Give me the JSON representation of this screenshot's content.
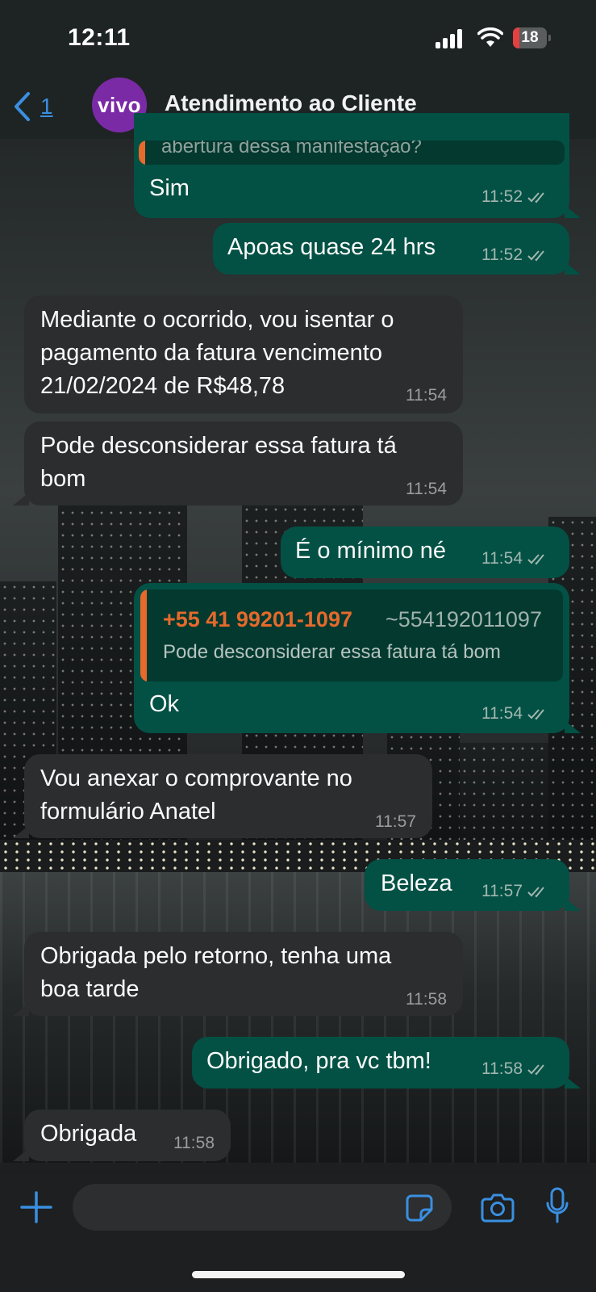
{
  "status_bar": {
    "time": "12:11",
    "battery": "18",
    "battery_level": 0.18
  },
  "header": {
    "back_count": "1",
    "avatar_text": "vivo",
    "title": "Atendimento ao Cliente"
  },
  "messages": [
    {
      "dir": "out",
      "quote_text": "abertura dessa manifestação?",
      "text": "Sim",
      "time": "11:52"
    },
    {
      "dir": "out",
      "text": "Apoas quase 24 hrs",
      "time": "11:52"
    },
    {
      "dir": "in",
      "text": "Mediante o ocorrido, vou isentar o\npagamento da fatura vencimento\n21/02/2024 de R$48,78",
      "time": "11:54"
    },
    {
      "dir": "in",
      "text": "Pode desconsiderar essa fatura tá\nbom",
      "time": "11:54"
    },
    {
      "dir": "out",
      "text": "É o mínimo né",
      "time": "11:54"
    },
    {
      "dir": "out",
      "quote_sender": "+55 41 99201-1097",
      "quote_number": "~554192011097",
      "quote_text": "Pode desconsiderar essa fatura tá bom",
      "text": "Ok",
      "time": "11:54"
    },
    {
      "dir": "in",
      "text": "Vou anexar o comprovante no\nformulário Anatel",
      "time": "11:57"
    },
    {
      "dir": "out",
      "text": "Beleza",
      "time": "11:57"
    },
    {
      "dir": "in",
      "text": "Obrigada pelo retorno, tenha uma\nboa tarde",
      "time": "11:58"
    },
    {
      "dir": "out",
      "text": "Obrigado, pra vc tbm!",
      "time": "11:58"
    },
    {
      "dir": "in",
      "text": "Obrigada",
      "time": "11:58"
    }
  ],
  "input": {
    "placeholder": ""
  },
  "icons": {
    "back": "chevron-left-icon",
    "plus": "plus-icon",
    "sticker": "sticker-icon",
    "camera": "camera-icon",
    "mic": "microphone-icon",
    "read": "double-check-icon"
  },
  "colors": {
    "accent": "#3a8fe0",
    "outgoing": "#025144",
    "incoming": "#2b2d2e",
    "quote_sender": "#e56a2c",
    "avatar": "#7b2aa6"
  }
}
